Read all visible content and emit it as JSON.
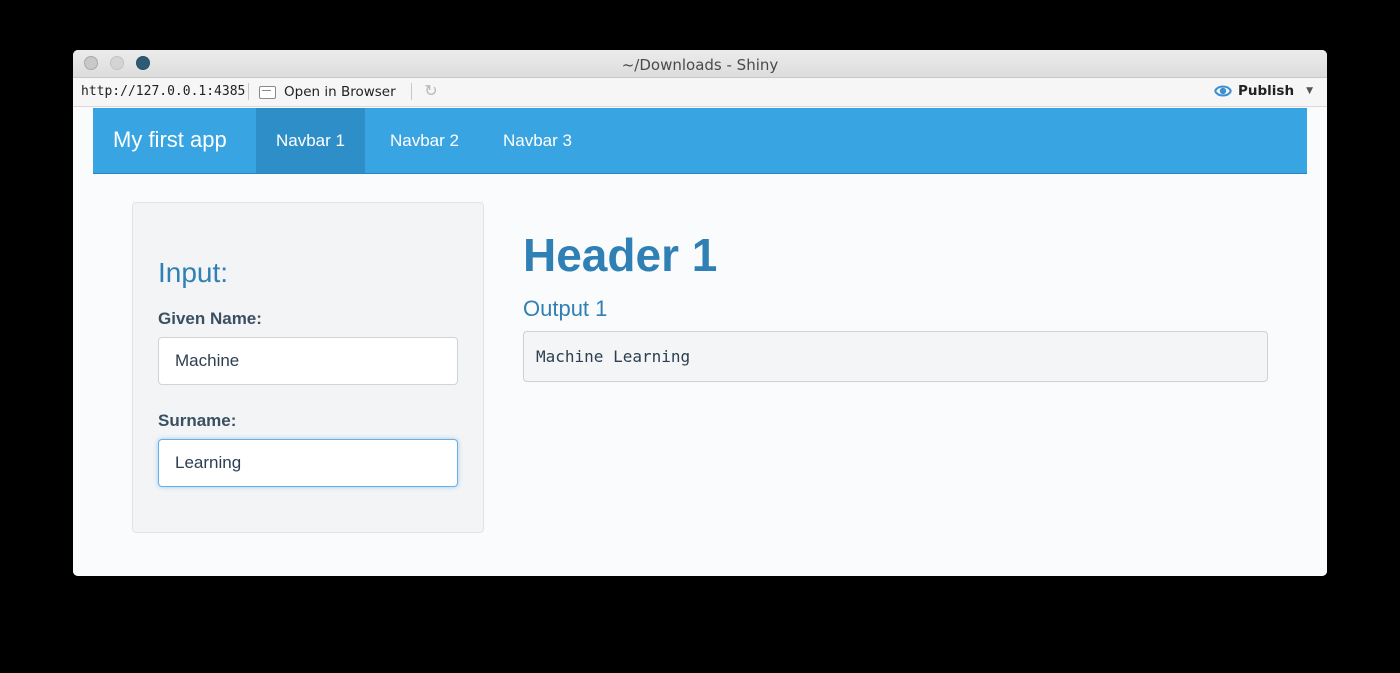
{
  "window": {
    "title": "~/Downloads - Shiny"
  },
  "toolbar": {
    "url": "http://127.0.0.1:4385",
    "open_in_browser": "Open in Browser",
    "publish": "Publish"
  },
  "navbar": {
    "brand": "My first app",
    "items": [
      {
        "label": "Navbar 1",
        "active": true
      },
      {
        "label": "Navbar 2",
        "active": false
      },
      {
        "label": "Navbar 3",
        "active": false
      }
    ]
  },
  "sidebar": {
    "heading": "Input:",
    "given_name_label": "Given Name:",
    "given_name_value": "Machine",
    "surname_label": "Surname:",
    "surname_value": "Learning"
  },
  "main": {
    "header": "Header 1",
    "subheader": "Output 1",
    "output_text": "Machine Learning"
  },
  "colors": {
    "navbar": "#38a4e1",
    "navbar_active": "#2e8fc8",
    "heading": "#2f80b5",
    "label": "#3a4f63"
  }
}
